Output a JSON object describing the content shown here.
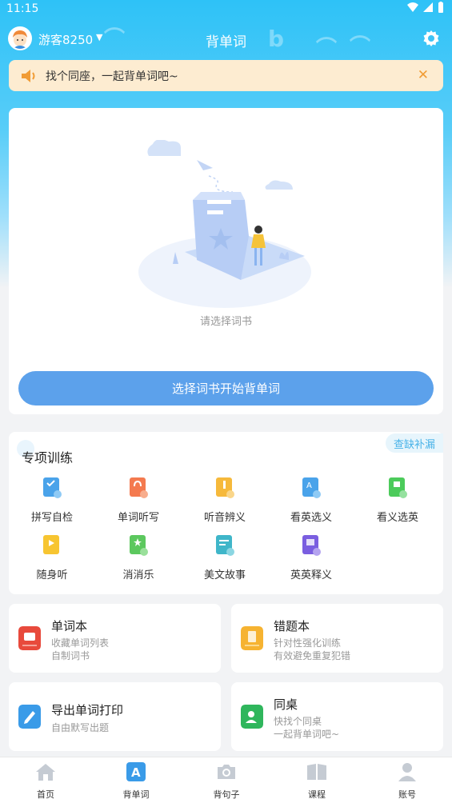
{
  "status_bar": {
    "time": "11:15"
  },
  "header": {
    "username": "游客8250",
    "dropdown_glyph": "▼",
    "title": "背单词"
  },
  "notice": {
    "text": "找个同座，一起背单词吧~",
    "close_glyph": "✕"
  },
  "main_card": {
    "hint": "请选择词书",
    "button_label": "选择词书开始背单词"
  },
  "training": {
    "title": "专项训练",
    "tag": "查缺补漏",
    "items": [
      {
        "label": "拼写自检",
        "icon": "spell-check-icon",
        "color": "#4aa3ea"
      },
      {
        "label": "单词听写",
        "icon": "dictation-icon",
        "color": "#f47a4f"
      },
      {
        "label": "听音辨义",
        "icon": "listen-meaning-icon",
        "color": "#f6b93b"
      },
      {
        "label": "看英选义",
        "icon": "english-to-meaning-icon",
        "color": "#4aa3ea"
      },
      {
        "label": "看义选英",
        "icon": "meaning-to-english-icon",
        "color": "#4ccb5b"
      },
      {
        "label": "随身听",
        "icon": "portable-listen-icon",
        "color": "#f7c531"
      },
      {
        "label": "消消乐",
        "icon": "match-game-icon",
        "color": "#5cc85e"
      },
      {
        "label": "美文故事",
        "icon": "story-icon",
        "color": "#3fb6c9"
      },
      {
        "label": "英英释义",
        "icon": "english-definition-icon",
        "color": "#7a5ee0"
      }
    ]
  },
  "cards": [
    {
      "title": "单词本",
      "lines": [
        "收藏单词列表",
        "自制词书"
      ],
      "icon": "wordbook-icon",
      "color": "#e84a3c"
    },
    {
      "title": "错题本",
      "lines": [
        "针对性强化训练",
        "有效避免重复犯错"
      ],
      "icon": "mistake-book-icon",
      "color": "#f6b331"
    },
    {
      "title": "导出单词打印",
      "lines": [
        "自由默写出题"
      ],
      "icon": "export-print-icon",
      "color": "#3a9be8"
    },
    {
      "title": "同桌",
      "lines": [
        "快找个同桌",
        "一起背单词吧~"
      ],
      "icon": "deskmate-icon",
      "color": "#2fb65c"
    }
  ],
  "bottom_nav": [
    {
      "label": "首页",
      "icon": "home-icon"
    },
    {
      "label": "背单词",
      "icon": "words-icon",
      "active": true
    },
    {
      "label": "背句子",
      "icon": "camera-icon"
    },
    {
      "label": "课程",
      "icon": "book-icon"
    },
    {
      "label": "账号",
      "icon": "account-icon"
    }
  ]
}
